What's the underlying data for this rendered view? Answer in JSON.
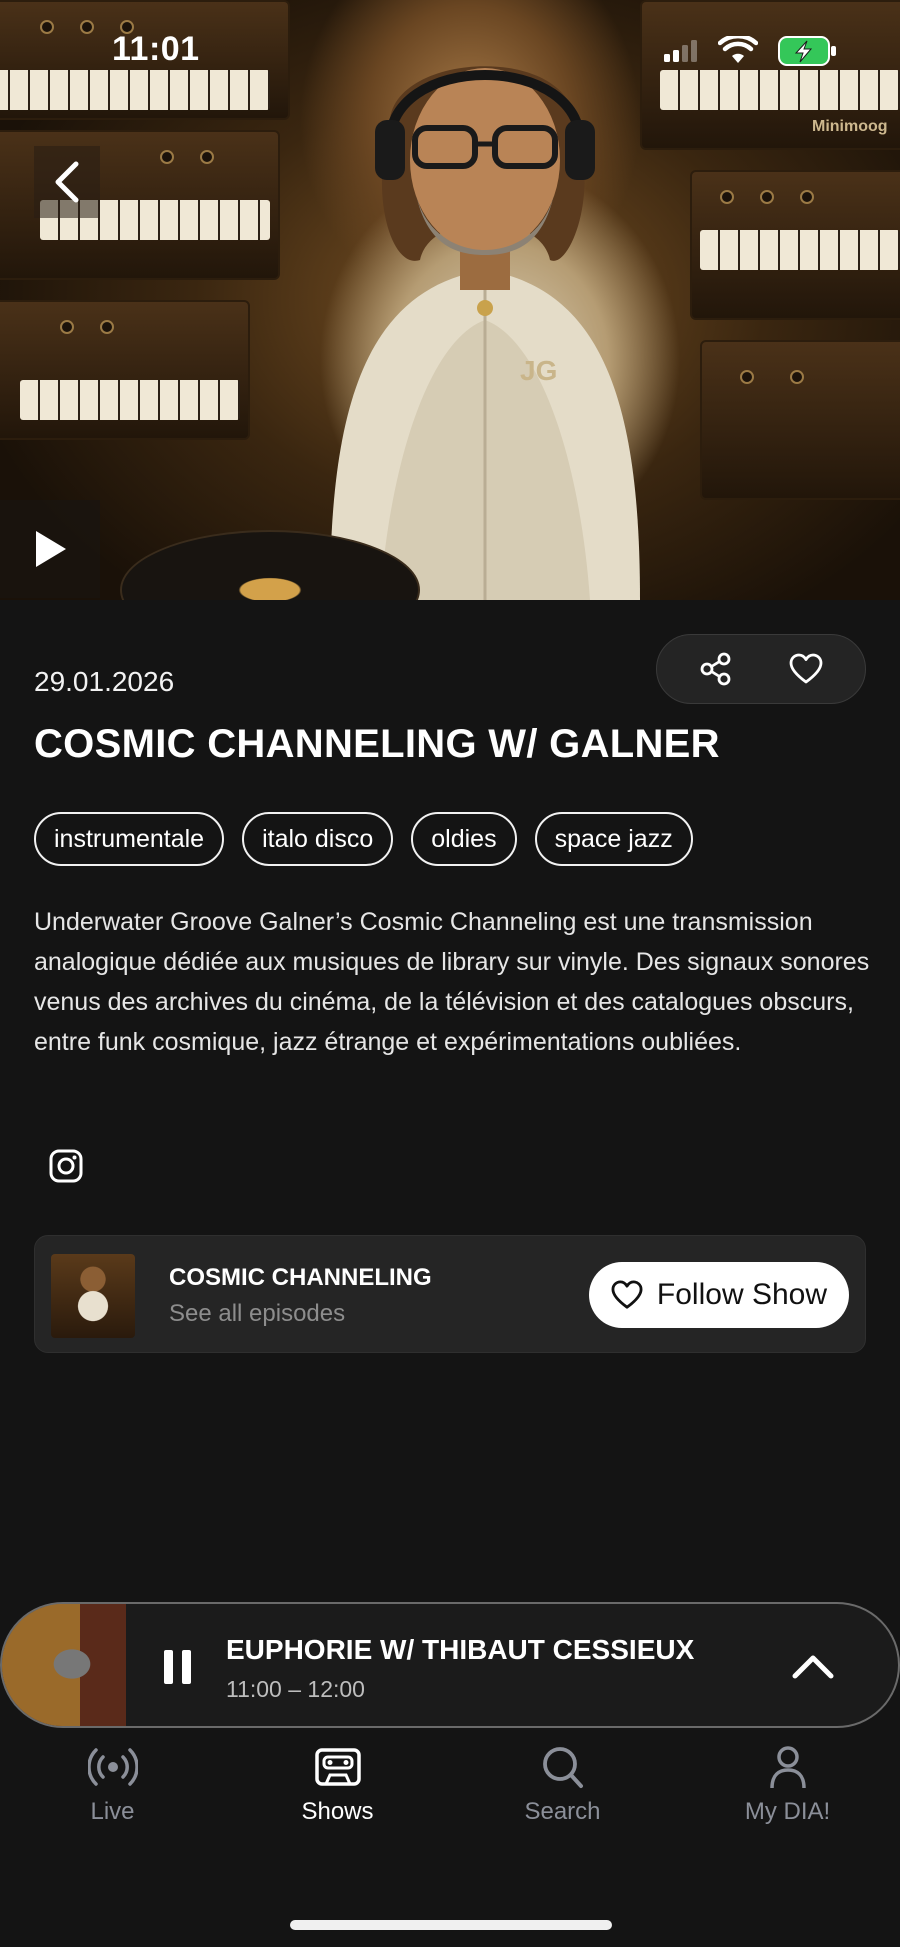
{
  "status_bar": {
    "time": "11:01"
  },
  "hero": {
    "image_text": "Minimoog",
    "monogram": "JG"
  },
  "episode": {
    "date": "29.01.2026",
    "title": "COSMIC CHANNELING W/ GALNER",
    "tags": [
      "instrumentale",
      "italo disco",
      "oldies",
      "space jazz"
    ],
    "description": "Underwater Groove Galner’s Cosmic Channeling est une transmission analogique dédiée aux musiques de library sur vinyle. Des signaux sonores venus des archives du cinéma, de la télévision et des catalogues obscurs, entre funk cosmique, jazz étrange et expérimentations oubliées."
  },
  "show_card": {
    "name": "COSMIC CHANNELING",
    "subtitle": "See all episodes",
    "follow_label": "Follow Show"
  },
  "mini_player": {
    "title": "EUPHORIE W/ THIBAUT CESSIEUX",
    "time": "11:00 – 12:00"
  },
  "tab_bar": {
    "active": "Shows",
    "tabs": [
      {
        "label": "Live",
        "icon": "broadcast-icon"
      },
      {
        "label": "Shows",
        "icon": "cassette-icon"
      },
      {
        "label": "Search",
        "icon": "search-icon"
      },
      {
        "label": "My DIA!",
        "icon": "person-icon"
      }
    ]
  },
  "colors": {
    "background": "#141414",
    "card": "#252525",
    "active_tab": "#ffffff",
    "inactive_tab": "#8b8f99",
    "battery": "#34c759"
  }
}
